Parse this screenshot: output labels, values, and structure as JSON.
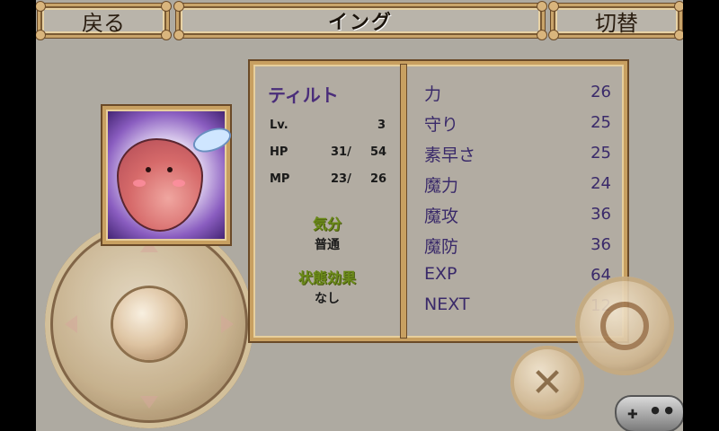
{
  "header": {
    "back_label": "戻る",
    "title": "イング",
    "switch_label": "切替"
  },
  "character": {
    "name": "ティルト",
    "lv_label": "Lv.",
    "lv_value": "3",
    "hp_label": "HP",
    "hp_current": "31/",
    "hp_max": "54",
    "mp_label": "MP",
    "mp_current": "23/",
    "mp_max": "26",
    "mood_label": "気分",
    "mood_value": "普通",
    "status_label": "状態効果",
    "status_value": "なし"
  },
  "params": [
    {
      "label": "力",
      "value": "26"
    },
    {
      "label": "守り",
      "value": "25"
    },
    {
      "label": "素早さ",
      "value": "25"
    },
    {
      "label": "魔力",
      "value": "24"
    },
    {
      "label": "魔攻",
      "value": "36"
    },
    {
      "label": "魔防",
      "value": "36"
    },
    {
      "label": "EXP",
      "value": "64"
    },
    {
      "label": "NEXT",
      "value": "12"
    }
  ],
  "controls": {
    "cancel_glyph": "✕"
  }
}
